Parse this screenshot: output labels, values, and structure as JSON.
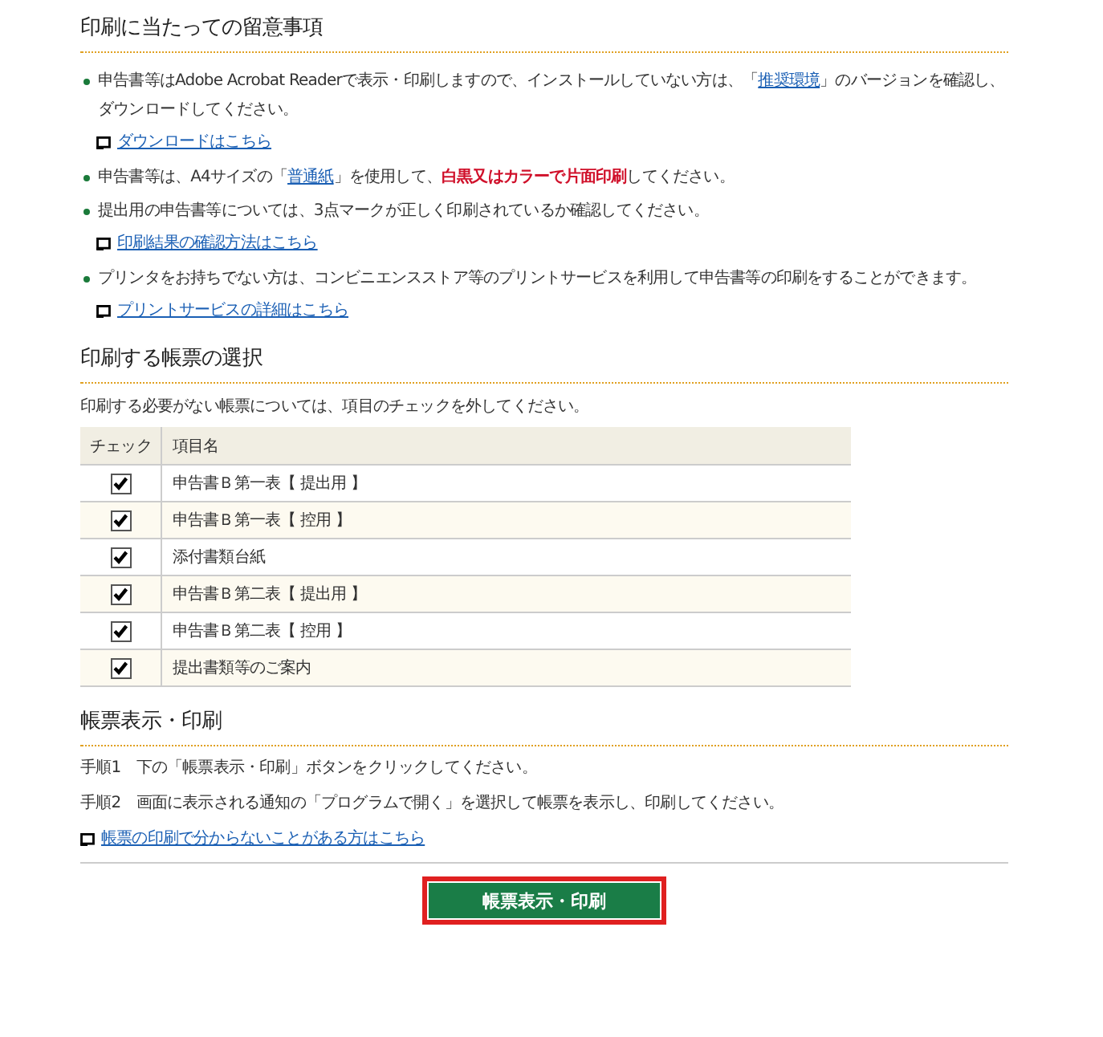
{
  "sections": [
    {
      "title": "印刷に当たっての留意事項",
      "kind": "notes",
      "items": [
        {
          "kind": "bullet",
          "segments": [
            {
              "kind": "plain",
              "text": "申告書等はAdobe Acrobat Readerで表示・印刷しますので、インストールしていない方は、「"
            },
            {
              "kind": "link",
              "text": "推奨環境"
            },
            {
              "kind": "plain",
              "text": "」のバージョンを確認し、ダウンロードしてください。"
            }
          ]
        },
        {
          "kind": "link",
          "text": "ダウンロードはこちら"
        },
        {
          "kind": "bullet",
          "segments": [
            {
              "kind": "plain",
              "text": "申告書等は、A4サイズの「"
            },
            {
              "kind": "link",
              "text": "普通紙"
            },
            {
              "kind": "plain",
              "text": "」を使用して、"
            },
            {
              "kind": "emphasis",
              "text": "白黒又はカラーで片面印刷"
            },
            {
              "kind": "plain",
              "text": "してください。"
            }
          ]
        },
        {
          "kind": "bullet",
          "segments": [
            {
              "kind": "plain",
              "text": "提出用の申告書等については、3点マークが正しく印刷されているか確認してください。"
            }
          ]
        },
        {
          "kind": "link",
          "text": "印刷結果の確認方法はこちら"
        },
        {
          "kind": "bullet",
          "segments": [
            {
              "kind": "plain",
              "text": "プリンタをお持ちでない方は、コンビニエンスストア等のプリントサービスを利用して申告書等の印刷をすることができます。"
            }
          ]
        },
        {
          "kind": "link",
          "text": "プリントサービスの詳細はこちら"
        }
      ]
    },
    {
      "title": "印刷する帳票の選択",
      "kind": "table",
      "intro": "印刷する必要がない帳票については、項目のチェックを外してください。",
      "columns": [
        "チェック",
        "項目名"
      ],
      "rows": [
        {
          "name": "申告書Ｂ第一表【 提出用 】",
          "checked": true
        },
        {
          "name": "申告書Ｂ第一表【 控用 】",
          "checked": true
        },
        {
          "name": "添付書類台紙",
          "checked": true
        },
        {
          "name": "申告書Ｂ第二表【 提出用 】",
          "checked": true
        },
        {
          "name": "申告書Ｂ第二表【 控用 】",
          "checked": true
        },
        {
          "name": "提出書類等のご案内",
          "checked": true
        }
      ]
    },
    {
      "title": "帳票表示・印刷",
      "kind": "steps",
      "steps": [
        "手順1　下の「帳票表示・印刷」ボタンをクリックしてください。",
        "手順2　画面に表示される通知の「プログラムで開く」を選択して帳票を表示し、印刷してください。"
      ],
      "link": "帳票の印刷で分からないことがある方はこちら"
    }
  ],
  "button": "帳票表示・印刷"
}
